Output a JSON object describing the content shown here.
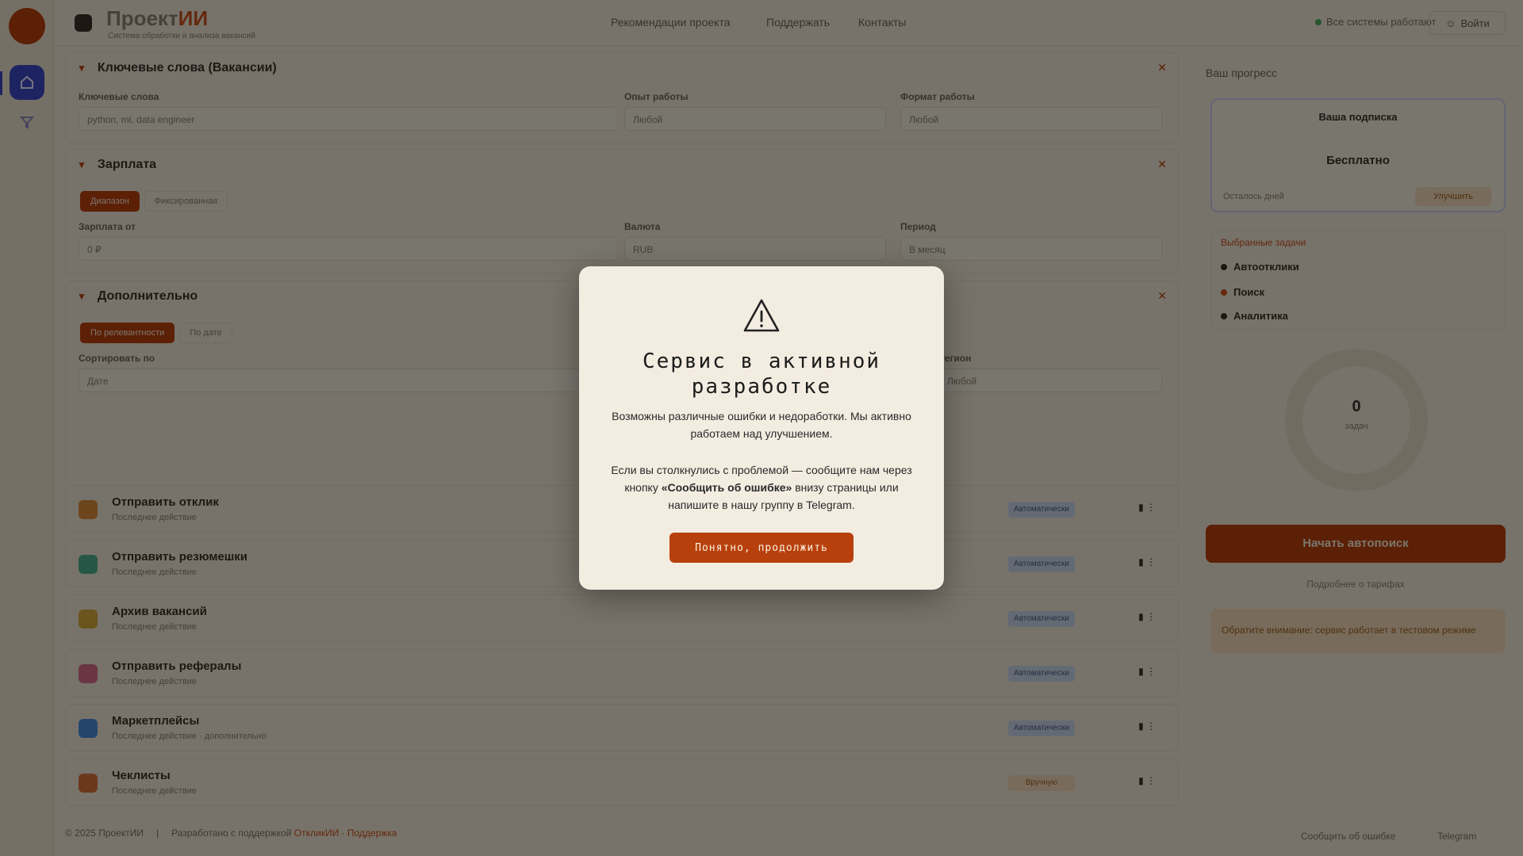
{
  "app": {
    "brand_text": "Проект",
    "brand_accent": "ИИ",
    "brand_subtitle": "Система обработки и анализа вакансий"
  },
  "topbar": {
    "nav": [
      "Рекомендации проекта",
      "Поддержать",
      "Контакты"
    ],
    "status": "Все системы работают",
    "action_button": "Войти"
  },
  "filters": {
    "section1_title": "Ключевые слова (Вакансии)",
    "field1_label": "Ключевые слова",
    "field1_value": "python, ml, data engineer",
    "field2_label": "Опыт работы",
    "field2_value": "Любой",
    "field3_label": "Формат работы",
    "field3_value": "Любой",
    "section2_title": "Зарплата",
    "toggle2a": "Диапазон",
    "toggle2b": "Фиксированная",
    "field4_label": "Зарплата от",
    "field4_value": "0 ₽",
    "field5_label": "Валюта",
    "field5_value": "RUB",
    "field6_label": "Период",
    "field6_value": "В месяц",
    "section3_title": "Дополнительно",
    "toggle3a": "По релевантности",
    "toggle3b": "По дате",
    "field7_label": "Сортировать по",
    "field7_value": "Дате",
    "field8_label": "Регион",
    "field8_value": "Любой"
  },
  "jobs": [
    {
      "title": "Отправить отклик",
      "sub": "Последнее действие",
      "tag": "Автоматически",
      "icon_color": "#d98a3a"
    },
    {
      "title": "Отправить резюмешки",
      "sub": "Последнее действие",
      "tag": "Автоматически",
      "icon_color": "#4cae8c"
    },
    {
      "title": "Архив вакансий",
      "sub": "Последнее действие",
      "tag": "Автоматически",
      "icon_color": "#d9a83a"
    },
    {
      "title": "Отправить рефералы",
      "sub": "Последнее действие",
      "tag": "Автоматически",
      "icon_color": "#d96a8a"
    },
    {
      "title": "Маркетплейсы",
      "sub": "Последнее действие · дополнительно",
      "tag": "Автоматически",
      "icon_color": "#4a8ad9"
    },
    {
      "title": "Чеклисты",
      "sub": "Последнее действие",
      "tag": "Вручную",
      "icon_color": "#d9703a"
    }
  ],
  "sidebar": {
    "title": "Ваш прогресс",
    "card_title": "Ваша подписка",
    "card_value": "Бесплатно",
    "card_meta": "Осталось дней",
    "card_button": "Улучшить",
    "list_head": "Выбранные задачи",
    "list_items": [
      "Автоотклики",
      "Поиск",
      "Аналитика"
    ],
    "ring_value": "0",
    "ring_label": "задач",
    "cta": "Начать автопоиск",
    "note": "Подробнее о тарифах",
    "warning": "Обратите внимание: сервис работает в тестовом режиме"
  },
  "footer": {
    "copyright": "© 2025 ПроектИИ",
    "text": "Разработано с поддержкой",
    "link": "ОткликИИ · Поддержка",
    "right1": "Сообщить об ошибке",
    "right2": "Telegram"
  },
  "modal": {
    "title": "Сервис в активной разработке",
    "p1": "Возможны различные ошибки и недоработки. Мы активно работаем над улучшением.",
    "p2_before": "Если вы столкнулись с проблемой — сообщите нам через кнопку",
    "p2_bold": "«Сообщить об ошибке»",
    "p2_after": "внизу страницы или напишите в нашу группу в Telegram.",
    "button": "Понятно, продолжить",
    "icon": "warning-triangle-icon"
  },
  "colors": {
    "accent": "#b8400c",
    "background": "#efe6d4",
    "modal_bg": "#f3ece0",
    "rail_active": "#3d49c4"
  }
}
